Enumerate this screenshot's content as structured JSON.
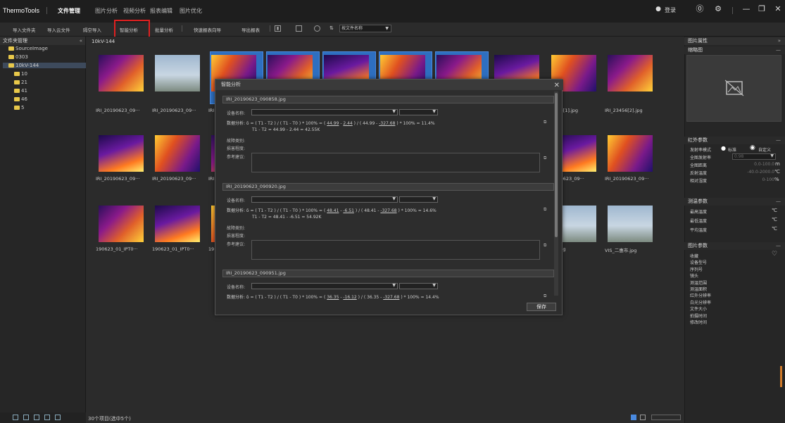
{
  "app": {
    "name": "ThermoTools",
    "menu_tabs": [
      "文件管理",
      "图片分析",
      "视频分析",
      "报表编辑",
      "图片优化"
    ],
    "active_tab": 0,
    "login_label": "登录"
  },
  "toolbar": {
    "buttons": [
      "导入文件夹",
      "导入云文件",
      "隔空导入",
      "智能分析",
      "批量分析",
      "快速报表向导",
      "导出报表"
    ],
    "sort_select": "按文件名称"
  },
  "left_panel": {
    "title": "文件夹管理",
    "tree": [
      {
        "label": "SourceImage",
        "level": 0
      },
      {
        "label": "0303",
        "level": 0
      },
      {
        "label": "10kV-144",
        "level": 0,
        "selected": true
      },
      {
        "label": "10",
        "level": 1
      },
      {
        "label": "21",
        "level": 1
      },
      {
        "label": "41",
        "level": 1
      },
      {
        "label": "46",
        "level": 1
      },
      {
        "label": "5",
        "level": 1
      }
    ]
  },
  "center": {
    "breadcrumb": "10kV-144",
    "status": "30个项目(选中5个)",
    "thumbnails": [
      {
        "label": "IRI_20190623_09···",
        "style": "ir",
        "selected": false
      },
      {
        "label": "IRI_20190623_09···",
        "style": "photo",
        "selected": false
      },
      {
        "label": "IRI",
        "style": "ir",
        "selected": true
      },
      {
        "label": "",
        "style": "ir",
        "selected": true
      },
      {
        "label": "",
        "style": "ir",
        "selected": true
      },
      {
        "label": "",
        "style": "ir",
        "selected": true
      },
      {
        "label": "",
        "style": "ir",
        "selected": true
      },
      {
        "label": "",
        "style": "ir",
        "selected": false
      },
      {
        "label": "23456[1].jpg",
        "style": "ir",
        "selected": false
      },
      {
        "label": "IRI_23456[2].jpg",
        "style": "ir",
        "selected": false
      },
      {
        "label": "IRI_20190623_09···",
        "style": "ir",
        "selected": false
      },
      {
        "label": "IRI_20190623_09···",
        "style": "ir",
        "selected": false
      },
      {
        "label": "IRI",
        "style": "ir",
        "selected": false
      },
      {
        "label": "20190623_09···",
        "style": "ir",
        "selected": false
      },
      {
        "label": "IRI_20190623_09···",
        "style": "ir",
        "selected": false
      },
      {
        "label": "190623_01_IPT0···",
        "style": "ir",
        "selected": false
      },
      {
        "label": "190623_01_IPT0···",
        "style": "ir",
        "selected": false
      },
      {
        "label": "19",
        "style": "ir",
        "selected": false
      },
      {
        "label": "341.jpg",
        "style": "photo",
        "selected": false
      },
      {
        "label": "VIS_二惠市.jpg",
        "style": "photo",
        "selected": false
      }
    ]
  },
  "right_panel": {
    "title": "图片属性",
    "thumbnail_section": "缩略图",
    "ir_section": {
      "title": "红外参数",
      "emissivity_mode_label": "发射率模式",
      "mode_standard": "标准",
      "mode_custom": "自定义",
      "rows": [
        {
          "label": "全图发射率",
          "value": "0.98"
        },
        {
          "label": "全图距离",
          "value": "0.0-100.0",
          "unit": "m"
        },
        {
          "label": "反射温度",
          "value": "-40.0-2000.0",
          "unit": "℃"
        },
        {
          "label": "相对湿度",
          "value": "0-100",
          "unit": "%"
        }
      ]
    },
    "measure_section": {
      "title": "测温参数",
      "rows": [
        {
          "label": "最高温度",
          "unit": "℃"
        },
        {
          "label": "最低温度",
          "unit": "℃"
        },
        {
          "label": "平均温度",
          "unit": "℃"
        }
      ]
    },
    "image_section": {
      "title": "图片参数",
      "rows": [
        "收藏",
        "设备型号",
        "序列号",
        "镜头",
        "测温范围",
        "测温面积",
        "红外分辨率",
        "白光分辨率",
        "文件大小",
        "拍摄时间",
        "修改时间"
      ]
    }
  },
  "modal": {
    "title": "智能分析",
    "save_label": "保存",
    "device_label": "设备名称:",
    "analysis_label": "数据分析:",
    "fault_type_label": "故障类别:",
    "damage_label": "损害程度:",
    "advice_label": "参考建议:",
    "records": [
      {
        "file": "IRI_20190623_090858.jpg",
        "formula_a": "δ = ( T1 - T2 ) / ( T1 - T0 ) * 100% = (",
        "t1": "44.99",
        "t2": "2.44",
        "formula_b": ") / ( 44.99 -",
        "t0": "-327.68",
        "formula_c": ") * 100% = 11.4%",
        "delta": "T1 - T2 = 44.99 - 2.44 = 42.55K"
      },
      {
        "file": "IRI_20190623_090920.jpg",
        "formula_a": "δ = ( T1 - T2 ) / ( T1 - T0 ) * 100% = (",
        "t1": "48.41",
        "t2": "-6.51",
        "formula_b": ") / ( 48.41 -",
        "t0": "-327.68",
        "formula_c": ") * 100% = 14.6%",
        "delta": "T1 - T2 = 48.41 - -6.51 = 54.92K"
      },
      {
        "file": "IRI_20190623_090951.jpg",
        "formula_a": "δ = ( T1 - T2 ) / ( T1 - T0 ) * 100% = (",
        "t1": "36.35",
        "t2": "-16.12",
        "formula_b": ") / ( 36.35 -",
        "t0": "-327.68",
        "formula_c": ") * 100% = 14.4%",
        "delta": ""
      }
    ]
  },
  "colors": {
    "highlight": "#e02020",
    "selection": "#2e6fc0",
    "accent_orange": "#d07a2a"
  }
}
